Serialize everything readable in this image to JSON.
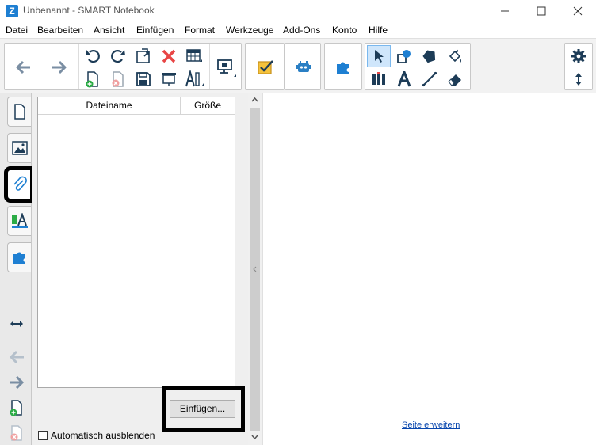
{
  "window": {
    "title": "Unbenannt - SMART Notebook",
    "app_icon": "smart-notebook-logo"
  },
  "menu": [
    "Datei",
    "Bearbeiten",
    "Ansicht",
    "Einfügen",
    "Format",
    "Werkzeuge",
    "Add-Ons",
    "Konto",
    "Hilfe"
  ],
  "panel": {
    "columns": {
      "name": "Dateiname",
      "size": "Größe"
    },
    "insert_label": "Einfügen...",
    "autohide_label": "Automatisch ausblenden"
  },
  "canvas": {
    "expand_link": "Seite erweitern"
  },
  "colors": {
    "accent": "#1e7fd2",
    "toolbar_bg": "#f2f2f2",
    "active_tool": "#cfe6fb",
    "link": "#0645ad",
    "dark_icon": "#1d3c57",
    "green": "#2bab45",
    "red": "#e84545"
  }
}
